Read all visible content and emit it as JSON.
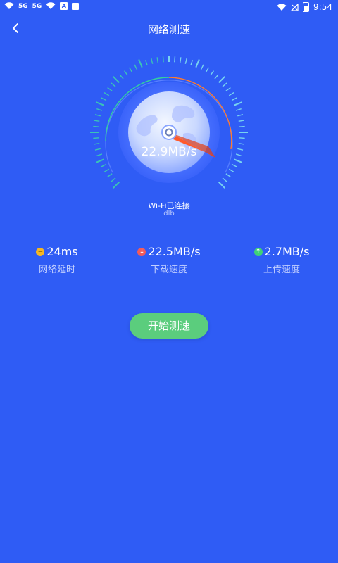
{
  "status_bar": {
    "left_labels": [
      "5G",
      "5G"
    ],
    "app_indicator": "A",
    "time": "9:54"
  },
  "header": {
    "title": "网络测速"
  },
  "gauge": {
    "speed_text": "22.9MB/s",
    "colors": {
      "background": "#2f5cf5",
      "dial": "#d8e3ff",
      "needle": "#ff5a2c",
      "arc_green": "#33d0a0",
      "arc_orange": "#ff7a2f"
    }
  },
  "wifi": {
    "status": "Wi-Fi已连接",
    "name": "dlb"
  },
  "stats": [
    {
      "icon": "latency-icon",
      "value": "24ms",
      "label": "网络延时"
    },
    {
      "icon": "download-icon",
      "value": "22.5MB/s",
      "label": "下载速度"
    },
    {
      "icon": "upload-icon",
      "value": "2.7MB/s",
      "label": "上传速度"
    }
  ],
  "actions": {
    "start_label": "开始测速"
  }
}
